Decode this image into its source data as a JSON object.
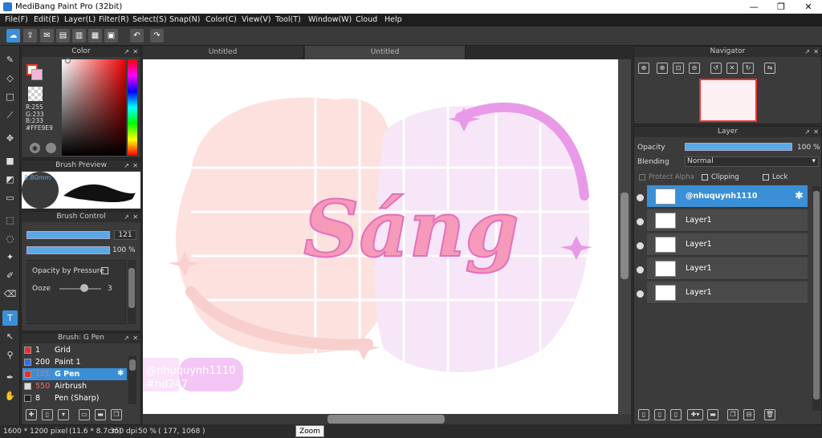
{
  "window": {
    "title": "MediBang Paint Pro (32bit)",
    "min": "—",
    "max": "❐",
    "close": "✕"
  },
  "menu": [
    "File(F)",
    "Edit(E)",
    "Layer(L)",
    "Filter(R)",
    "Select(S)",
    "Snap(N)",
    "Color(C)",
    "View(V)",
    "Tool(T)",
    "Window(W)",
    "Cloud",
    "Help"
  ],
  "tabs": [
    "Untitled",
    "Untitled"
  ],
  "panels": {
    "color": {
      "title": "Color",
      "r": "R:255",
      "g": "G:233",
      "b": "B:233",
      "hex": "#FFE9E9",
      "accent": "#FFE9E9"
    },
    "brush_preview": {
      "title": "Brush Preview",
      "size": "8.80mm"
    },
    "brush_control": {
      "title": "Brush Control",
      "size_value": "121",
      "opacity_value": "100 %",
      "opacity_by_pressure": "Opacity by Pressure",
      "ooze": "Ooze",
      "ooze_value": "3"
    },
    "brush_list": {
      "title": "Brush: G Pen",
      "items": [
        {
          "size": "1",
          "name": "Grid",
          "color": "#e83030"
        },
        {
          "size": "200",
          "name": "Paint 1",
          "color": "#2f6fe8"
        },
        {
          "size": "121",
          "name": "G Pen",
          "color": "#e83030"
        },
        {
          "size": "550",
          "name": "Airbrush",
          "color": "#dddddd"
        },
        {
          "size": "8",
          "name": "Pen (Sharp)",
          "color": "#222222"
        }
      ]
    },
    "navigator": {
      "title": "Navigator"
    },
    "layer": {
      "title": "Layer",
      "opacity_label": "Opacity",
      "opacity_value": "100 %",
      "blending_label": "Blending",
      "blending_value": "Normal",
      "protect_alpha": "Protect Alpha",
      "clipping": "Clipping",
      "lock": "Lock",
      "layers": [
        {
          "name": "@nhuquynh1110",
          "selected": true
        },
        {
          "name": "Layer1",
          "selected": false
        },
        {
          "name": "Layer1",
          "selected": false
        },
        {
          "name": "Layer1",
          "selected": false
        },
        {
          "name": "Layer1",
          "selected": false
        }
      ]
    }
  },
  "artwork": {
    "lettering": "Sáng",
    "watermark1": "@nhuquynh1110",
    "watermark2": "#hd247"
  },
  "status": {
    "dimensions": "1600 * 1200 pixel",
    "physical": "(11.6 * 8.7cm)",
    "dpi": "350 dpi",
    "zoom": "50 %",
    "coords": "( 177, 1068 )",
    "tooltip": "Zoom"
  }
}
